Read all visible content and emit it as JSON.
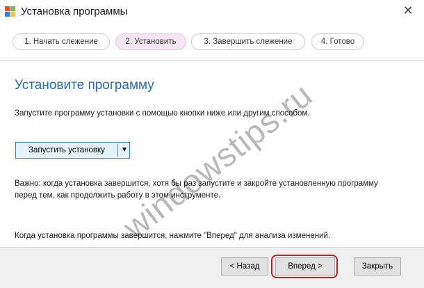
{
  "window": {
    "title": "Установка программы",
    "close_glyph": "✕"
  },
  "icons": {
    "app_icon": "windows-logo-icon",
    "close_icon": "close-icon",
    "dropdown_icon": "dropdown-arrow-icon"
  },
  "colors": {
    "heading": "#2b6ea8",
    "active_step": "#f6e6f4",
    "highlight": "#d11a1a",
    "logo_red": "#e84b2c",
    "logo_green": "#7cb342",
    "logo_blue": "#1e88e5",
    "logo_yellow": "#fbc02d"
  },
  "steps": [
    {
      "label": "1. Начать слежение",
      "active": false
    },
    {
      "label": "2. Установить",
      "active": true
    },
    {
      "label": "3. Завершить слежение",
      "active": false
    },
    {
      "label": "4. Готово",
      "active": false
    }
  ],
  "content": {
    "heading": "Установите программу",
    "description": "Запустите программу установки с помощью кнопки ниже или другим способом.",
    "run_button_label": "Запустить установку",
    "run_button_arrow": "▼",
    "note_line1": "Важно: когда установка завершится, хотя бы раз запустите и закройте установленную программу",
    "note_line2": "перед тем, как продолжить работу в этом инструменте.",
    "footer_hint": "Когда установка программы завершится, нажмите \"Вперед\" для анализа изменений."
  },
  "buttons": {
    "back": "< Назад",
    "next": "Вперед >",
    "close": "Закрыть"
  },
  "watermark": "windowstips.ru"
}
